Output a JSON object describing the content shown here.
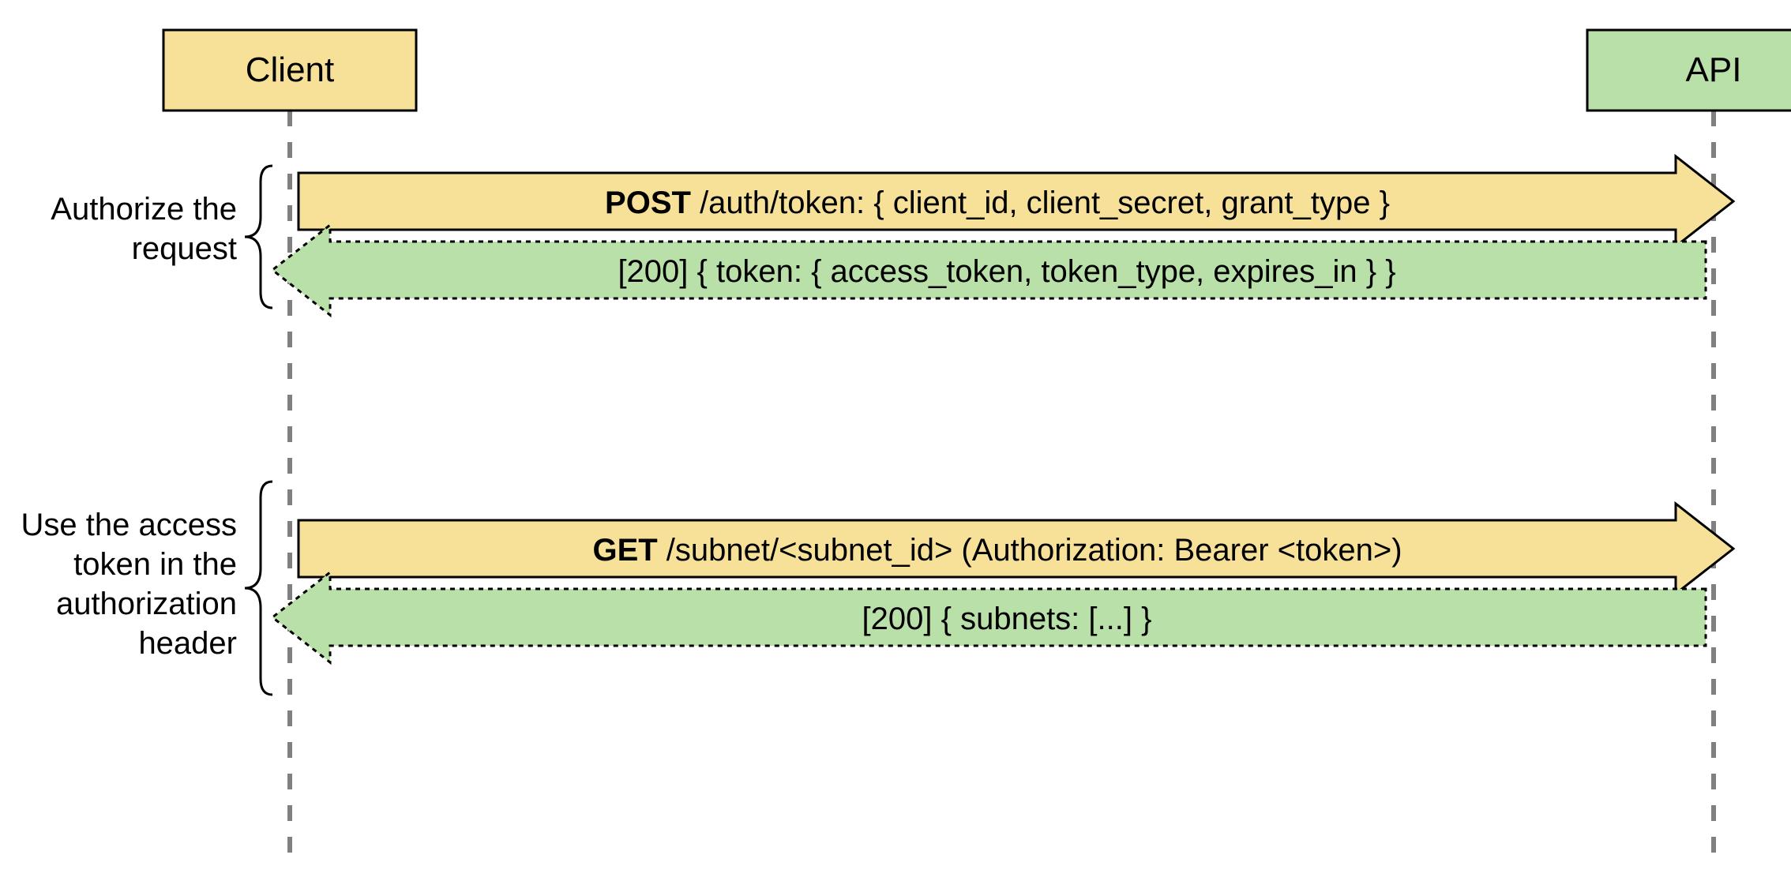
{
  "actors": {
    "client": "Client",
    "api": "API"
  },
  "groups": {
    "auth": {
      "label_line1": "Authorize the",
      "label_line2": "request"
    },
    "use": {
      "label_line1": "Use the access",
      "label_line2": "token in the",
      "label_line3": "authorization",
      "label_line4": "header"
    }
  },
  "messages": {
    "auth_req_method": "POST",
    "auth_req_rest": " /auth/token: { client_id, client_secret, grant_type }",
    "auth_res": "[200] { token: { access_token, token_type, expires_in } }",
    "use_req_method": "GET",
    "use_req_rest": " /subnet/<subnet_id> (Authorization: Bearer <token>)",
    "use_res": "[200] { subnets: [...] }"
  },
  "colors": {
    "client_fill": "#f7e199",
    "api_fill": "#b9e0a8",
    "lifeline": "#808080"
  }
}
